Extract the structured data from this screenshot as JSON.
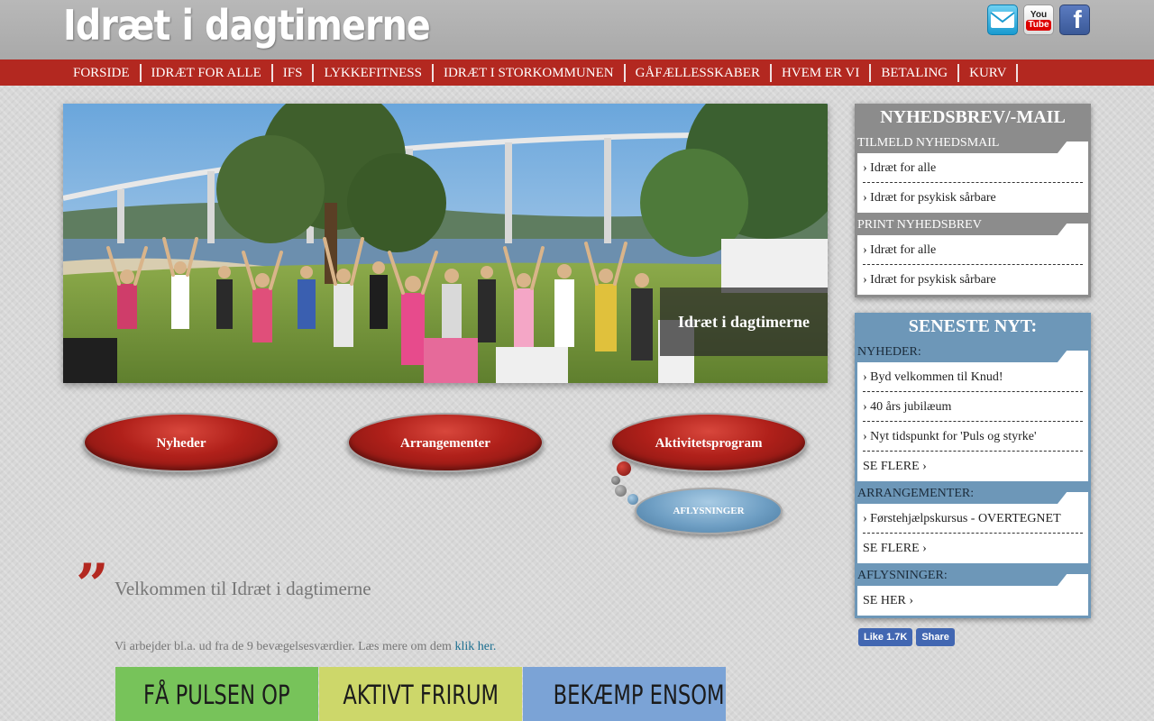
{
  "site": {
    "logo_text": "Idræt i dagtimerne"
  },
  "social": {
    "mail_icon": "mail-icon",
    "youtube_you": "You",
    "youtube_tube": "Tube",
    "facebook_letter": "f"
  },
  "nav": {
    "items": [
      "FORSIDE",
      "IDRÆT FOR ALLE",
      "IFS",
      "LYKKEFITNESS",
      "IDRÆT I STORKOMMUNEN",
      "GÅFÆLLESSKABER",
      "HVEM ER VI",
      "BETALING",
      "KURV"
    ]
  },
  "hero": {
    "caption": "Idræt i dagtimerne"
  },
  "buttons": {
    "news": "Nyheder",
    "events": "Arrangementer",
    "program": "Aktivitetsprogram",
    "cancellations": "AFLYSNINGER"
  },
  "welcome": {
    "quote_mark": "”",
    "title": "Velkommen til Idræt i dagtimerne",
    "intro_text": "Vi arbejder bl.a. ud fra de 9 bevægelsesværdier. Læs mere om dem ",
    "intro_link": "klik her."
  },
  "values": [
    {
      "label": "FÅ PULSEN OP",
      "color": "#77c35a"
    },
    {
      "label": "AKTIVT FRIRUM",
      "color": "#cdd76a"
    },
    {
      "label": "BEKÆMP ENSOMHED",
      "color": "#7ba3d6"
    }
  ],
  "newsletter": {
    "title": "NYHEDSBREV/-MAIL",
    "subscribe_heading": "TILMELD NYHEDSMAIL",
    "subscribe_links": [
      "› Idræt for alle",
      "› Idræt for psykisk sårbare"
    ],
    "print_heading": "PRINT NYHEDSBREV",
    "print_links": [
      "› Idræt for alle",
      "› Idræt for psykisk sårbare"
    ]
  },
  "latest": {
    "title": "SENESTE NYT:",
    "news_heading": "NYHEDER:",
    "news_links": [
      "› Byd velkommen til Knud!",
      "› 40 års jubilæum",
      "› Nyt tidspunkt for 'Puls og styrke'"
    ],
    "news_more": "SE FLERE ›",
    "events_heading": "ARRANGEMENTER:",
    "events_links": [
      "› Førstehjælpskursus - OVERTEGNET"
    ],
    "events_more": "SE FLERE ›",
    "cancel_heading": "AFLYSNINGER:",
    "cancel_link": "SE HER ›"
  },
  "facebook": {
    "like_label": "Like 1.7K",
    "share_label": "Share"
  },
  "colors": {
    "nav_red": "#b32820",
    "header_gray": "#a9a9a9",
    "sidebar_blue": "#6d97b8"
  }
}
